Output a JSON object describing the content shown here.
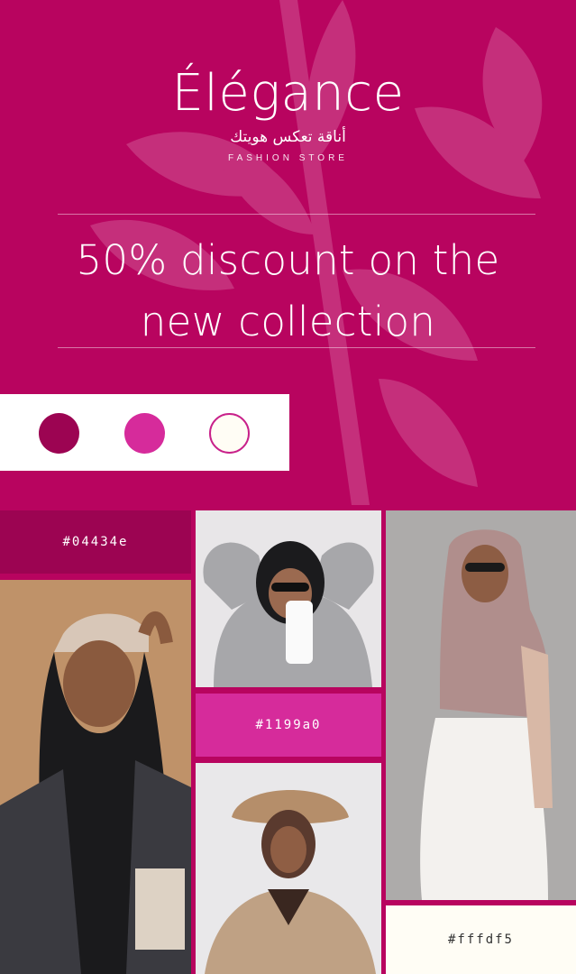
{
  "brand": {
    "name": "Élégance",
    "arabic_tagline": "أناقة تعكس هويتك",
    "subtitle": "FASHION STORE"
  },
  "headline": {
    "line1": "50% discount on the",
    "line2": "new collection"
  },
  "palette": [
    {
      "hex": "#04434e",
      "color": "#9c0452"
    },
    {
      "hex": "#1199a0",
      "color": "#d62b9b"
    },
    {
      "hex": "#fffdf5",
      "color": "#fffdf5"
    }
  ],
  "colors": {
    "background": "#b8045f",
    "dark_tile": "#9c0452",
    "mid_tile": "#d62b9b",
    "light_tile": "#fffdf5"
  },
  "photos": [
    {
      "name": "model-black-hijab-cap-photo"
    },
    {
      "name": "model-sunglasses-phone-photo"
    },
    {
      "name": "model-mauve-hijab-photo"
    },
    {
      "name": "model-beret-coat-photo"
    }
  ]
}
